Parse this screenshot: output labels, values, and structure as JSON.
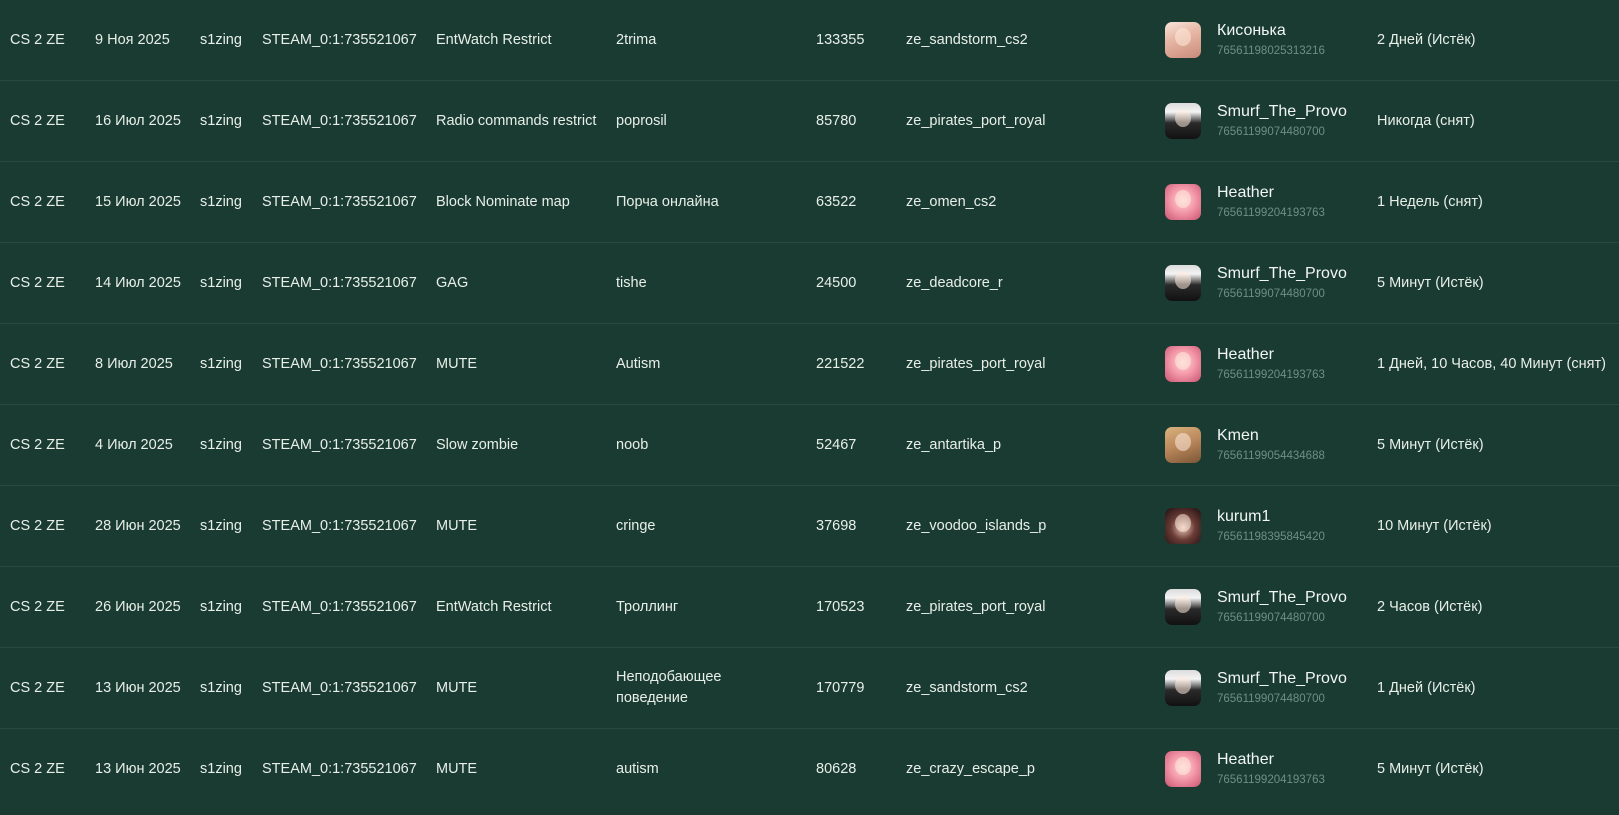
{
  "rows": [
    {
      "server": "CS 2 ZE",
      "date": "9 Ноя 2025",
      "admin": "s1zing",
      "steam": "STEAM_0:1:735521067",
      "type": "EntWatch Restrict",
      "reason": "2trima",
      "id": "133355",
      "map": "ze_sandstorm_cs2",
      "player_name": "Кисонька",
      "player_steam": "76561198025313216",
      "avatar": "av-kiss",
      "duration": "2 Дней (Истёк)"
    },
    {
      "server": "CS 2 ZE",
      "date": "16 Июл 2025",
      "admin": "s1zing",
      "steam": "STEAM_0:1:735521067",
      "type": "Radio commands restrict",
      "reason": "poprosil",
      "id": "85780",
      "map": "ze_pirates_port_royal",
      "player_name": "Smurf_The_Provo",
      "player_steam": "76561199074480700",
      "avatar": "av-smurf",
      "duration": "Никогда (снят)"
    },
    {
      "server": "CS 2 ZE",
      "date": "15 Июл 2025",
      "admin": "s1zing",
      "steam": "STEAM_0:1:735521067",
      "type": "Block Nominate map",
      "reason": "Порча онлайна",
      "id": "63522",
      "map": "ze_omen_cs2",
      "player_name": "Heather",
      "player_steam": "76561199204193763",
      "avatar": "av-heather",
      "duration": "1 Недель (снят)"
    },
    {
      "server": "CS 2 ZE",
      "date": "14 Июл 2025",
      "admin": "s1zing",
      "steam": "STEAM_0:1:735521067",
      "type": "GAG",
      "reason": "tishe",
      "id": "24500",
      "map": "ze_deadcore_r",
      "player_name": "Smurf_The_Provo",
      "player_steam": "76561199074480700",
      "avatar": "av-smurf",
      "duration": "5 Минут (Истёк)"
    },
    {
      "server": "CS 2 ZE",
      "date": "8 Июл 2025",
      "admin": "s1zing",
      "steam": "STEAM_0:1:735521067",
      "type": "MUTE",
      "reason": "Autism",
      "id": "221522",
      "map": "ze_pirates_port_royal",
      "player_name": "Heather",
      "player_steam": "76561199204193763",
      "avatar": "av-heather",
      "duration": "1 Дней, 10 Часов, 40 Минут (снят)"
    },
    {
      "server": "CS 2 ZE",
      "date": "4 Июл 2025",
      "admin": "s1zing",
      "steam": "STEAM_0:1:735521067",
      "type": "Slow zombie",
      "reason": "noob",
      "id": "52467",
      "map": "ze_antartika_p",
      "player_name": "Kmen",
      "player_steam": "76561199054434688",
      "avatar": "av-kmen",
      "duration": "5 Минут (Истёк)"
    },
    {
      "server": "CS 2 ZE",
      "date": "28 Июн 2025",
      "admin": "s1zing",
      "steam": "STEAM_0:1:735521067",
      "type": "MUTE",
      "reason": "cringe",
      "id": "37698",
      "map": "ze_voodoo_islands_p",
      "player_name": "kurum1",
      "player_steam": "76561198395845420",
      "avatar": "av-kurum",
      "duration": "10 Минут (Истёк)"
    },
    {
      "server": "CS 2 ZE",
      "date": "26 Июн 2025",
      "admin": "s1zing",
      "steam": "STEAM_0:1:735521067",
      "type": "EntWatch Restrict",
      "reason": "Троллинг",
      "id": "170523",
      "map": "ze_pirates_port_royal",
      "player_name": "Smurf_The_Provo",
      "player_steam": "76561199074480700",
      "avatar": "av-smurf",
      "duration": "2 Часов (Истёк)"
    },
    {
      "server": "CS 2 ZE",
      "date": "13 Июн 2025",
      "admin": "s1zing",
      "steam": "STEAM_0:1:735521067",
      "type": "MUTE",
      "reason": "Неподобающее поведение",
      "id": "170779",
      "map": "ze_sandstorm_cs2",
      "player_name": "Smurf_The_Provo",
      "player_steam": "76561199074480700",
      "avatar": "av-smurf",
      "duration": "1 Дней (Истёк)"
    },
    {
      "server": "CS 2 ZE",
      "date": "13 Июн 2025",
      "admin": "s1zing",
      "steam": "STEAM_0:1:735521067",
      "type": "MUTE",
      "reason": "autism",
      "id": "80628",
      "map": "ze_crazy_escape_p",
      "player_name": "Heather",
      "player_steam": "76561199204193763",
      "avatar": "av-heather",
      "duration": "5 Минут (Истёк)"
    }
  ]
}
